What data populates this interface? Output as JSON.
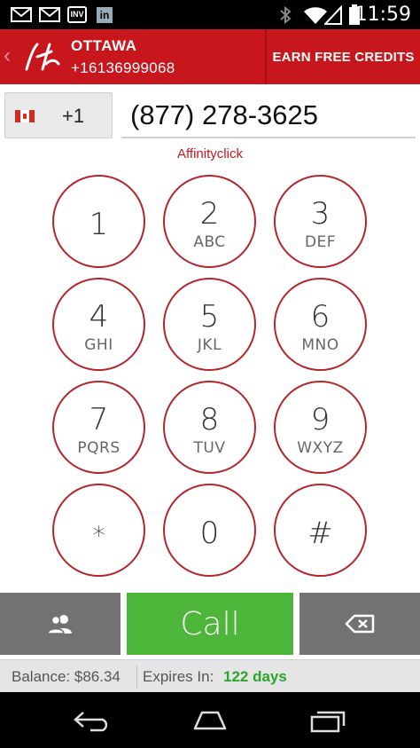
{
  "status_bar": {
    "time": "11:59",
    "icons": [
      "gmail-icon",
      "gmail-icon",
      "inv-icon",
      "linkedin-icon",
      "bluetooth-icon",
      "wifi-icon",
      "signal-icon",
      "battery-icon"
    ],
    "inv_label": "INV",
    "linkedin_label": "in"
  },
  "header": {
    "back_icon": "chevron-left-icon",
    "logo_text": "Hr",
    "city": "OTTAWA",
    "caller_number": "+16136999068",
    "earn_button_label": "EARN FREE CREDITS",
    "background_color": "#c8161d"
  },
  "dialer": {
    "country_flag": "canada-flag-icon",
    "country_code": "+1",
    "number_value": "(877) 278-3625",
    "caller_id_name": "Affinityclick"
  },
  "keypad": {
    "keys": [
      {
        "digit": "1",
        "letters": ""
      },
      {
        "digit": "2",
        "letters": "ABC"
      },
      {
        "digit": "3",
        "letters": "DEF"
      },
      {
        "digit": "4",
        "letters": "GHI"
      },
      {
        "digit": "5",
        "letters": "JKL"
      },
      {
        "digit": "6",
        "letters": "MNO"
      },
      {
        "digit": "7",
        "letters": "PQRS"
      },
      {
        "digit": "8",
        "letters": "TUV"
      },
      {
        "digit": "9",
        "letters": "WXYZ"
      },
      {
        "digit": "*",
        "letters": ""
      },
      {
        "digit": "0",
        "letters": ""
      },
      {
        "digit": "#",
        "letters": ""
      }
    ],
    "ring_color": "#b3262b"
  },
  "actions": {
    "contacts_icon": "contacts-icon",
    "call_label": "Call",
    "call_color": "#4cb53a",
    "backspace_icon": "backspace-icon"
  },
  "balance": {
    "balance_text": "Balance: $86.34",
    "expires_label": "Expires In:",
    "expires_value": "122 days",
    "expires_color": "#2ea52a"
  },
  "nav": {
    "back_icon": "nav-back-icon",
    "home_icon": "nav-home-icon",
    "recents_icon": "nav-recents-icon"
  }
}
